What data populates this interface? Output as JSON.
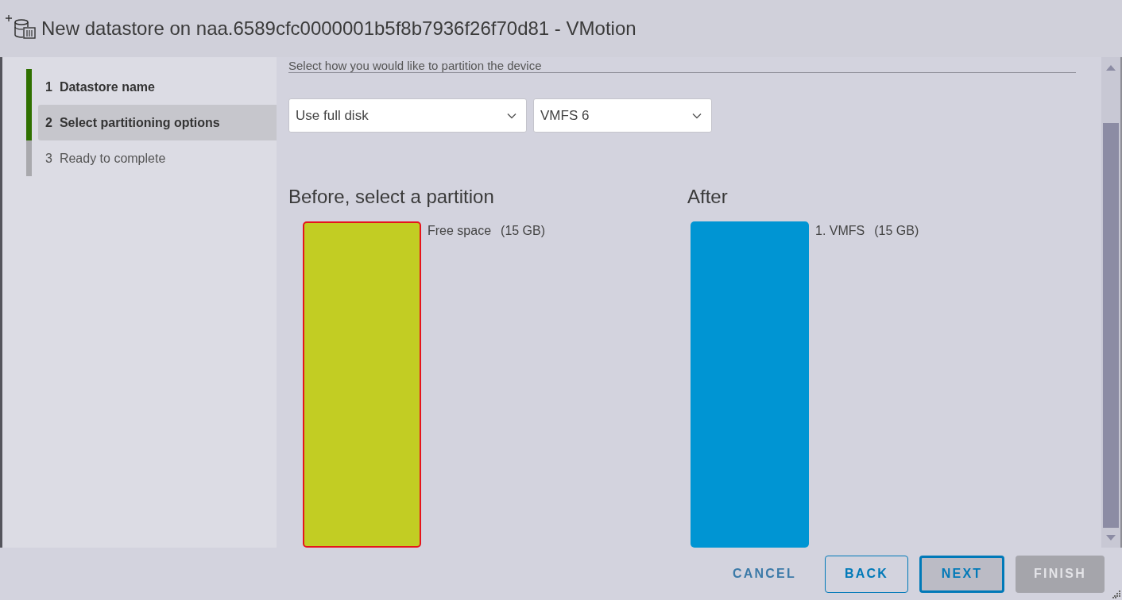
{
  "window": {
    "title": "New datastore on naa.6589cfc0000001b5f8b7936f26f70d81 - VMotion"
  },
  "steps": [
    {
      "number": "1",
      "label": "Datastore name",
      "completed": true,
      "selected": false
    },
    {
      "number": "2",
      "label": "Select partitioning options",
      "completed": true,
      "selected": true
    },
    {
      "number": "3",
      "label": "Ready to complete",
      "completed": false,
      "selected": false
    }
  ],
  "content": {
    "instruction": "Select how you would like to partition the device",
    "partition_option": {
      "value": "Use full disk"
    },
    "filesystem": {
      "value": "VMFS 6"
    }
  },
  "before": {
    "heading": "Before, select a partition",
    "partitions": [
      {
        "label": "Free space",
        "size": "(15 GB)",
        "color": "#c2cd23",
        "selected": true
      }
    ]
  },
  "after": {
    "heading": "After",
    "partitions": [
      {
        "label": "1. VMFS",
        "size": "(15 GB)",
        "color": "#0095d3",
        "selected": false
      }
    ]
  },
  "buttons": [
    {
      "label": "CANCEL",
      "kind": "flat",
      "focused": false,
      "disabled": false
    },
    {
      "label": "BACK",
      "kind": "outline",
      "focused": false,
      "disabled": false
    },
    {
      "label": "NEXT",
      "kind": "outline",
      "focused": true,
      "disabled": false
    },
    {
      "label": "FINISH",
      "kind": "solid",
      "focused": false,
      "disabled": true
    }
  ]
}
